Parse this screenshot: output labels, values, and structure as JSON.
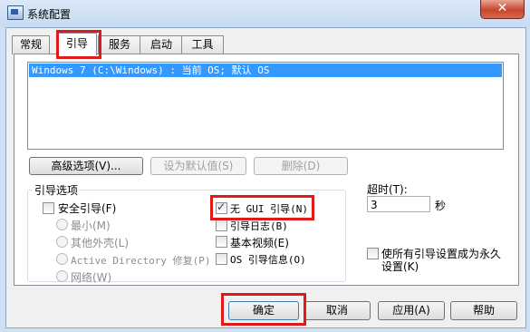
{
  "window": {
    "title": "系统配置",
    "close_glyph": "✕"
  },
  "tabs": [
    {
      "label": "常规"
    },
    {
      "label": "引导"
    },
    {
      "label": "服务"
    },
    {
      "label": "启动"
    },
    {
      "label": "工具"
    }
  ],
  "os_list": {
    "items": [
      "Windows 7 (C:\\Windows) : 当前 OS; 默认 OS"
    ]
  },
  "buttons": {
    "advanced": "高级选项(V)...",
    "set_default": "设为默认值(S)",
    "delete": "删除(D)"
  },
  "boot_options": {
    "title": "引导选项",
    "safe_boot": {
      "label": "安全引导(F)",
      "checked": false
    },
    "minimal": {
      "label": "最小(M)"
    },
    "alternate_shell": {
      "label": "其他外壳(L)"
    },
    "active_directory": {
      "label": "Active Directory 修复(P)"
    },
    "network": {
      "label": "网络(W)"
    },
    "no_gui_boot": {
      "label": "无 GUI 引导(N)",
      "checked": true
    },
    "boot_log": {
      "label": "引导日志(B)",
      "checked": false
    },
    "base_video": {
      "label": "基本视频(E)",
      "checked": false
    },
    "os_boot_info": {
      "label": "OS 引导信息(O)",
      "checked": false
    }
  },
  "timeout": {
    "label": "超时(T):",
    "value": "3",
    "unit": "秒"
  },
  "make_permanent": {
    "label_line1": "使所有引导设置成为永久",
    "label_line2": "设置(K)",
    "checked": false
  },
  "footer": {
    "ok": "确定",
    "cancel": "取消",
    "apply": "应用(A)",
    "help": "帮助"
  },
  "colors": {
    "highlight_box": "#e0191b",
    "selection": "#3399ff"
  }
}
